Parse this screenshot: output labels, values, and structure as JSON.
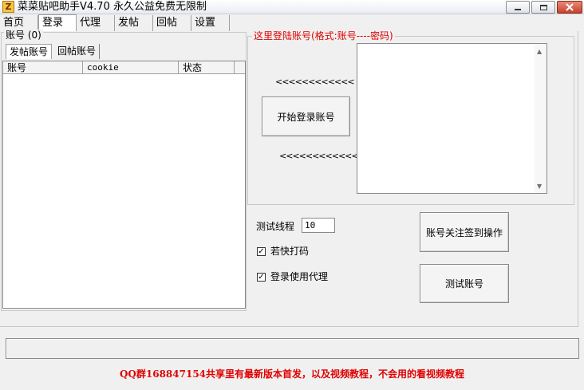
{
  "window": {
    "title": "菜菜贴吧助手V4.70  永久公益免费无限制",
    "icon_glyph": "Z"
  },
  "menu": {
    "items": [
      {
        "label": "首页"
      },
      {
        "label": "登录"
      },
      {
        "label": "代理"
      },
      {
        "label": "发帖"
      },
      {
        "label": "回帖"
      },
      {
        "label": "设置"
      }
    ],
    "active": "登录"
  },
  "accounts": {
    "group_title": "账号 (0)",
    "tabs": [
      {
        "label": "发帖账号"
      },
      {
        "label": "回帖账号"
      }
    ],
    "columns": [
      "账号",
      "cookie",
      "状态"
    ]
  },
  "login": {
    "hint": "这里登陆账号(格式:账号----密码)",
    "arrows_top": "<<<<<<<<<<<<",
    "arrows_bottom": "<<<<<<<<<<<<",
    "start_button": "开始登录账号"
  },
  "options": {
    "threads_label": "测试线程",
    "threads_value": "10",
    "fast_captcha_label": "若快打码",
    "fast_captcha_checked": true,
    "use_proxy_label": "登录使用代理",
    "use_proxy_checked": true,
    "follow_button": "账号关注签到操作",
    "test_button": "测试账号"
  },
  "footer": {
    "text": "QQ群168847154共享里有最新版本首发，以及视频教程，不会用的看视频教程"
  },
  "colors": {
    "accent_red": "#e00000",
    "background": "#f0f0f0"
  }
}
